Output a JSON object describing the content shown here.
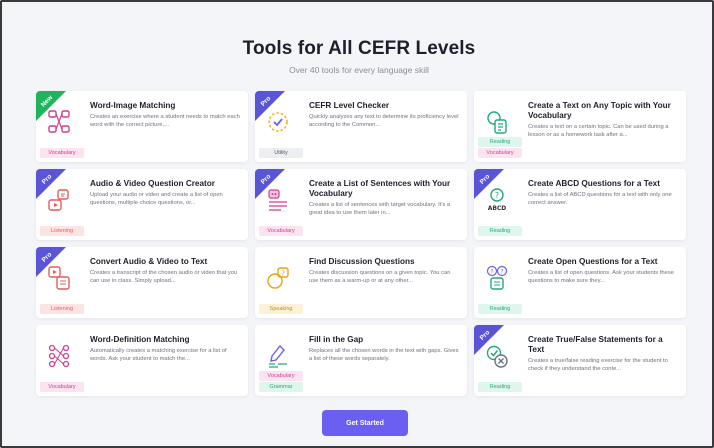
{
  "header": {
    "title": "Tools for All CEFR Levels",
    "subtitle": "Over 40 tools for every language skill"
  },
  "cards": [
    {
      "title": "Word-Image Matching",
      "desc": "Creates an exercise where a student needs to match each word with the correct picture,...",
      "badge": "New",
      "tags": [
        "Vocabulary"
      ],
      "icon": "match-icon"
    },
    {
      "title": "CEFR Level Checker",
      "desc": "Quickly analyzes any text to determine its proficiency level according to the Common...",
      "badge": "Pro",
      "tags": [
        "Utility"
      ],
      "icon": "level-check-icon"
    },
    {
      "title": "Create a Text on Any Topic with Your Vocabulary",
      "desc": "Creates a text on a certain topic. Can be used during a lesson or as a homework task after a...",
      "badge": "",
      "tags": [
        "Reading",
        "Vocabulary"
      ],
      "icon": "text-topic-icon"
    },
    {
      "title": "Audio & Video Question Creator",
      "desc": "Upload your audio or video and create a list of open questions, multiple choice questions, or...",
      "badge": "Pro",
      "tags": [
        "Listening"
      ],
      "icon": "audio-video-icon"
    },
    {
      "title": "Create a List of Sentences with Your Vocabulary",
      "desc": "Creates a list of sentences with target vocabulary. It's a great idea to use them later in...",
      "badge": "Pro",
      "tags": [
        "Vocabulary"
      ],
      "icon": "sentence-list-icon"
    },
    {
      "title": "Create ABCD Questions for a Text",
      "desc": "Creates a list of ABCD questions for a text with only one correct answer.",
      "badge": "Pro",
      "tags": [
        "Reading"
      ],
      "icon": "abcd-icon"
    },
    {
      "title": "Convert Audio & Video to Text",
      "desc": "Creates a transcript of the chosen audio or video that you can use in class. Simply upload...",
      "badge": "Pro",
      "tags": [
        "Listening"
      ],
      "icon": "transcript-icon"
    },
    {
      "title": "Find Discussion Questions",
      "desc": "Creates discussion questions on a given topic. You can use them as a warm-up or at any other...",
      "badge": "",
      "tags": [
        "Speaking"
      ],
      "icon": "discussion-icon"
    },
    {
      "title": "Create Open Questions for a Text",
      "desc": "Creates a list of open questions. Ask your students these questions to make sure they...",
      "badge": "",
      "tags": [
        "Reading"
      ],
      "icon": "open-questions-icon"
    },
    {
      "title": "Word-Definition Matching",
      "desc": "Automatically creates a matching exercise for a list of words. Ask your student to match the...",
      "badge": "",
      "tags": [
        "Vocabulary"
      ],
      "icon": "definition-match-icon"
    },
    {
      "title": "Fill in the Gap",
      "desc": "Replaces all the chosen words in the text with gaps. Gives a list of these words separately.",
      "badge": "",
      "tags": [
        "Vocabulary",
        "Grammar"
      ],
      "icon": "fill-gap-icon"
    },
    {
      "title": "Create True/False Statements for a Text",
      "desc": "Creates a true/false reading exercise for the student to check if they understand the conte...",
      "badge": "Pro",
      "tags": [
        "Reading"
      ],
      "icon": "true-false-icon"
    }
  ],
  "cta": {
    "label": "Get Started"
  },
  "colors": {
    "accent": "#6b5ff2",
    "pro_ribbon": "#5a54d6",
    "new_ribbon": "#1fb35b"
  }
}
